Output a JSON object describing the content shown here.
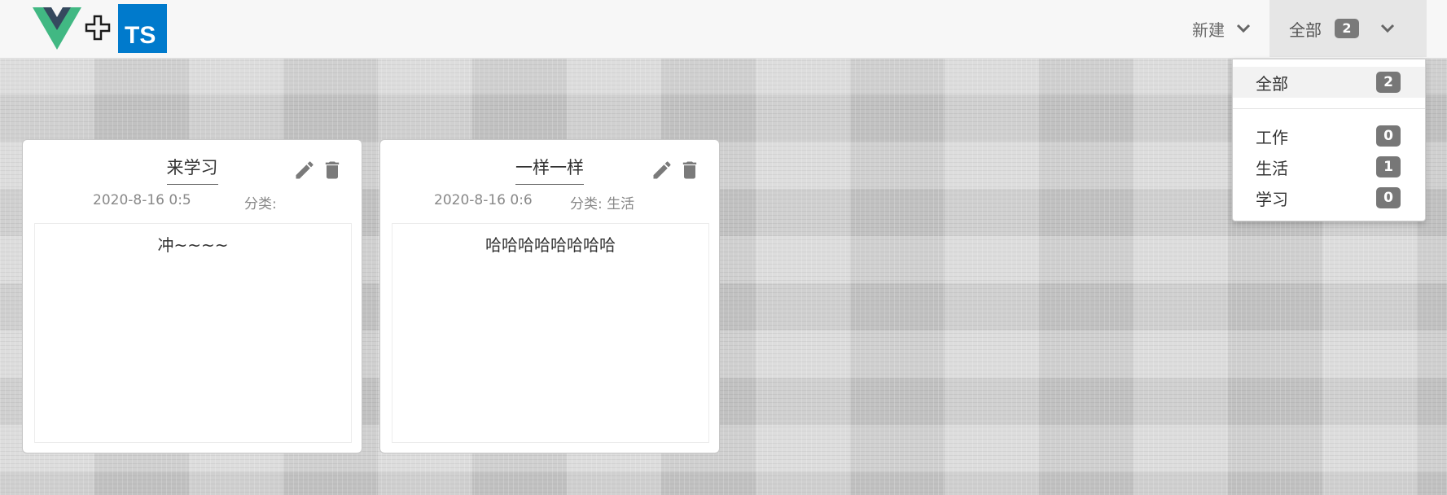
{
  "header": {
    "logo_icon": "vue-plus-typescript-logo",
    "logo_ts_text": "TS",
    "new_menu": {
      "label": "新建",
      "icon": "chevron-down-icon"
    },
    "filter_menu": {
      "label": "全部",
      "count": "2",
      "icon": "chevron-down-icon"
    }
  },
  "dropdown": {
    "items": [
      {
        "label": "全部",
        "count": "2"
      },
      {
        "label": "工作",
        "count": "0"
      },
      {
        "label": "生活",
        "count": "1"
      },
      {
        "label": "学习",
        "count": "0"
      }
    ]
  },
  "notes": [
    {
      "title": "来学习",
      "date": "2020-8-16 0:5",
      "category": "分类:",
      "content": "冲~~~~",
      "edit_icon": "pencil-icon",
      "delete_icon": "trash-icon"
    },
    {
      "title": "一样一样",
      "date": "2020-8-16 0:6",
      "category": "分类: 生活",
      "content": "哈哈哈哈哈哈哈哈",
      "edit_icon": "pencil-icon",
      "delete_icon": "trash-icon"
    }
  ],
  "colors": {
    "vue_green": "#41b883",
    "vue_dark": "#35495e",
    "ts_blue": "#007acc",
    "badge_gray": "#7a7a7a"
  }
}
